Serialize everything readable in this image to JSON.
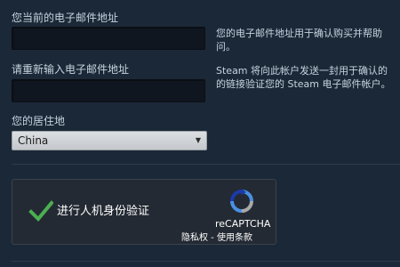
{
  "form": {
    "current_email_label": "您当前的电子邮件地址",
    "current_email_value": "",
    "current_email_help_line1": "您的电子邮件地址用于确认购买并帮助",
    "current_email_help_line2": "问。",
    "reenter_email_label": "请重新输入电子邮件地址",
    "reenter_email_value": "",
    "reenter_email_help_line1": "Steam 将向此帐户发送一封用于确认的",
    "reenter_email_help_line2": "的链接验证您的 Steam 电子邮件帐户。",
    "residence_label": "您的居住地",
    "residence_selected": "China"
  },
  "captcha": {
    "label": "进行人机身份验证",
    "brand": "reCAPTCHA",
    "privacy_link": "隐私权",
    "separator": " - ",
    "terms_link": "使用条款",
    "check_color": "#4caf50",
    "logo_icon": "recaptcha-logo-icon"
  },
  "colors": {
    "background": "#1b2838",
    "text": "#c6d4df",
    "input_background": "#10161f"
  }
}
